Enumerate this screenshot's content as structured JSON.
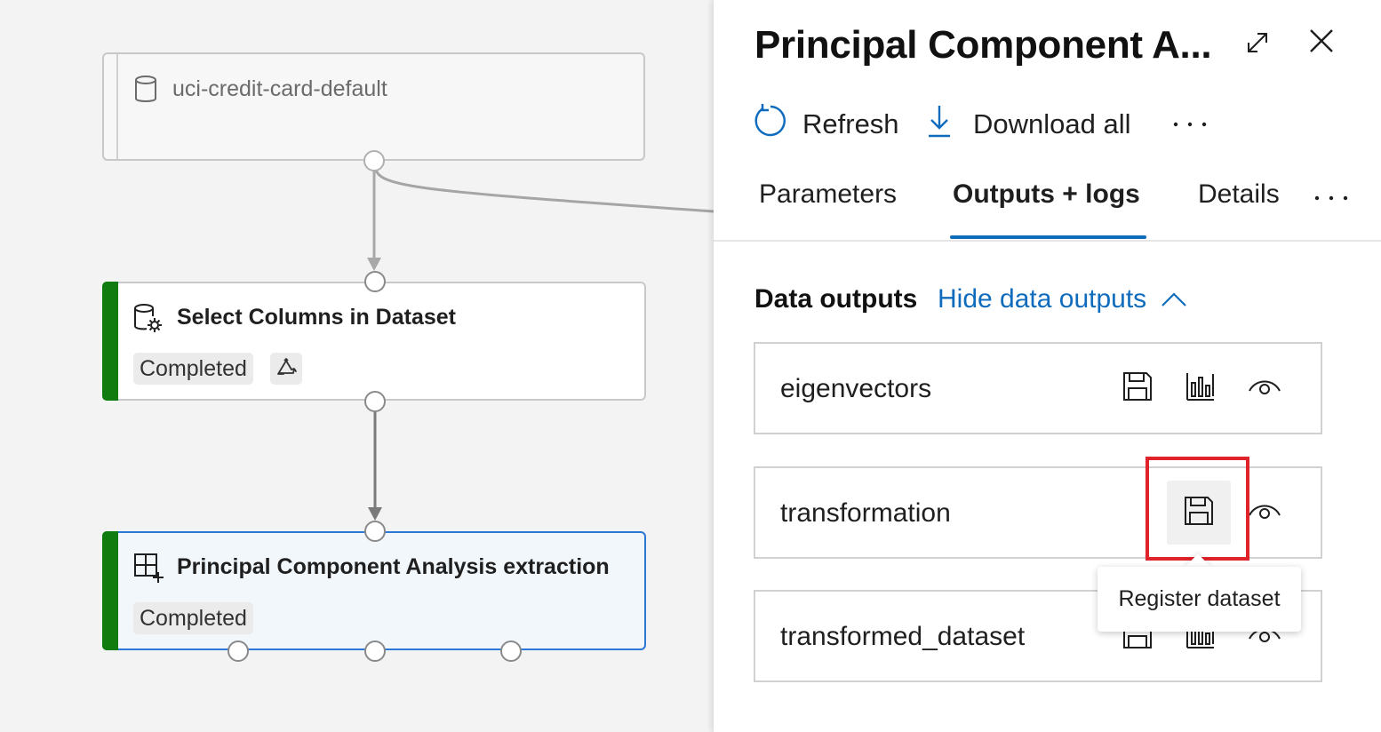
{
  "canvas": {
    "nodes": [
      {
        "title": "uci-credit-card-default",
        "state": "disabled",
        "icon": "dataset-icon"
      },
      {
        "title": "Select Columns in Dataset",
        "status": "Completed",
        "icon": "dataset-settings-icon",
        "extra_icon": "reuse-icon"
      },
      {
        "title": "Principal Component Analysis extraction",
        "status": "Completed",
        "icon": "grid-add-icon",
        "selected": true
      }
    ],
    "status_color": "#107c10"
  },
  "panel": {
    "title": "Principal Component A...",
    "toolbar": {
      "refresh_label": "Refresh",
      "download_label": "Download all"
    },
    "tabs": [
      {
        "label": "Parameters",
        "active": false
      },
      {
        "label": "Outputs + logs",
        "active": true
      },
      {
        "label": "Details",
        "active": false
      }
    ],
    "section": {
      "title": "Data outputs",
      "toggle_label": "Hide data outputs"
    },
    "outputs": [
      {
        "name": "eigenvectors",
        "actions": [
          "save-icon",
          "chart-icon",
          "eye-icon"
        ]
      },
      {
        "name": "transformation",
        "actions": [
          "save-icon",
          "eye-icon"
        ]
      },
      {
        "name": "transformed_dataset",
        "actions": [
          "save-icon",
          "chart-icon",
          "eye-icon"
        ]
      }
    ],
    "tooltip": "Register dataset",
    "accent_color": "#0f6cbd",
    "highlight_color": "#e0232b"
  }
}
